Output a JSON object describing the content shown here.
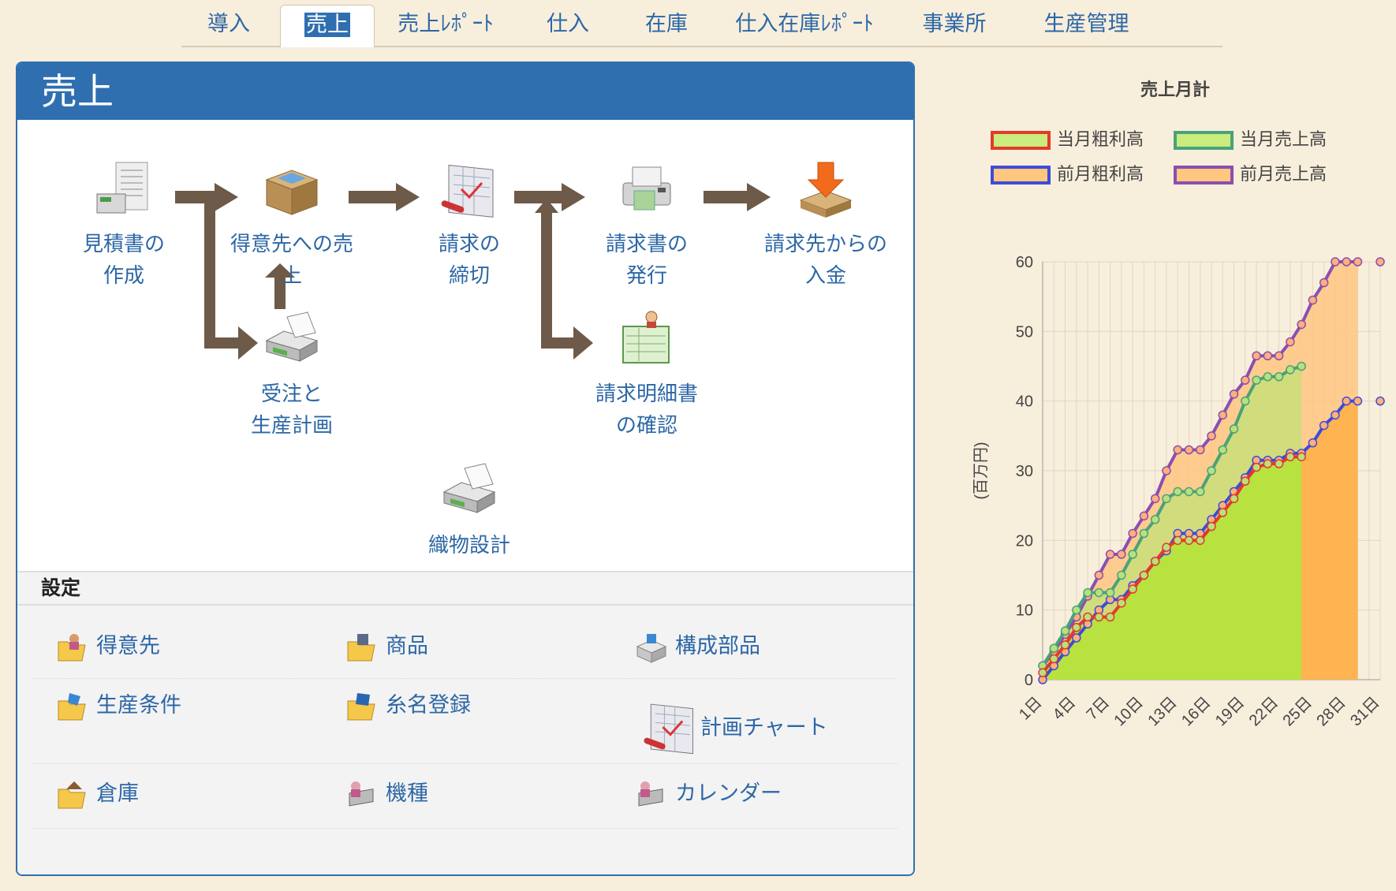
{
  "tabs": [
    {
      "label": "導入",
      "active": false
    },
    {
      "label": "売上",
      "active": true
    },
    {
      "label": "売上ﾚﾎﾟｰﾄ",
      "active": false
    },
    {
      "label": "仕入",
      "active": false
    },
    {
      "label": "在庫",
      "active": false
    },
    {
      "label": "仕入在庫ﾚﾎﾟｰﾄ",
      "active": false
    },
    {
      "label": "事業所",
      "active": false
    },
    {
      "label": "生産管理",
      "active": false
    }
  ],
  "panel": {
    "title": "売上",
    "flow": {
      "estimate": "見積書の\n作成",
      "sales": "得意先への売\n上",
      "closing": "請求の\n締切",
      "invoice": "請求書の\n発行",
      "payment": "請求先からの\n入金",
      "order": "受注と\n生産計画",
      "statement": "請求明細書\nの確認",
      "textile": "織物設計"
    },
    "settings_title": "設定",
    "settings": [
      {
        "label": "得意先",
        "icon": "folder-user-icon"
      },
      {
        "label": "商品",
        "icon": "folder-product-icon"
      },
      {
        "label": "構成部品",
        "icon": "parts-box-icon"
      },
      {
        "label": "生産条件",
        "icon": "folder-condition-icon"
      },
      {
        "label": "糸名登録",
        "icon": "folder-yarn-icon"
      },
      {
        "label": "計画チャート",
        "icon": "chart-sheet-icon"
      },
      {
        "label": "倉庫",
        "icon": "folder-warehouse-icon"
      },
      {
        "label": "機種",
        "icon": "machine-icon"
      },
      {
        "label": "カレンダー",
        "icon": "calendar-icon"
      }
    ]
  },
  "colors": {
    "accent": "#2f6fb0",
    "link": "#2c67a6",
    "background": "#f8eedc",
    "arrow": "#6e5a48",
    "cur_gross_line": "#e33a2b",
    "cur_sales_line": "#4aa27a",
    "prev_gross_line": "#3f4bd6",
    "prev_sales_line": "#8a4fb0",
    "green_fill": "#b5e33a",
    "orange_fill": "#ffb04a"
  },
  "chart_data": {
    "type": "area",
    "title": "売上月計",
    "ylabel": "(百万円)",
    "ylim": [
      0,
      60
    ],
    "yticks": [
      0,
      10,
      20,
      30,
      40,
      50,
      60
    ],
    "xticks": [
      "1日",
      "4日",
      "7日",
      "10日",
      "13日",
      "16日",
      "19日",
      "22日",
      "25日",
      "28日",
      "31日"
    ],
    "legend": [
      {
        "name": "当月粗利高",
        "fill": "#c9ec7c",
        "border": "#e33a2b"
      },
      {
        "name": "当月売上高",
        "fill": "#c9ec7c",
        "border": "#4aa27a"
      },
      {
        "name": "前月粗利高",
        "fill": "#ffc680",
        "border": "#3f4bd6"
      },
      {
        "name": "前月売上高",
        "fill": "#ffc680",
        "border": "#8a4fb0"
      }
    ],
    "series": [
      {
        "name": "当月売上高",
        "days": [
          1,
          2,
          3,
          4,
          5,
          6,
          7,
          8,
          9,
          10,
          11,
          12,
          13,
          14,
          15,
          16,
          17,
          18,
          19,
          20,
          21,
          22,
          23,
          24
        ],
        "values": [
          2,
          4.5,
          7,
          10,
          12.5,
          12.5,
          12.5,
          15,
          18,
          21,
          23,
          26,
          27,
          27,
          27,
          30,
          33,
          36,
          40,
          43,
          43.5,
          43.5,
          44.5,
          45
        ]
      },
      {
        "name": "当月粗利高",
        "days": [
          1,
          2,
          3,
          4,
          5,
          6,
          7,
          8,
          9,
          10,
          11,
          12,
          13,
          14,
          15,
          16,
          17,
          18,
          19,
          20,
          21,
          22,
          23,
          24
        ],
        "values": [
          1,
          3,
          5,
          7.5,
          9,
          9,
          9,
          11,
          13,
          15,
          17,
          19,
          20,
          20,
          20,
          22,
          24,
          26,
          28.5,
          30.5,
          31,
          31,
          32,
          32
        ]
      },
      {
        "name": "前月売上高",
        "days": [
          1,
          2,
          3,
          4,
          5,
          6,
          7,
          8,
          9,
          10,
          11,
          12,
          13,
          14,
          15,
          16,
          17,
          18,
          19,
          20,
          21,
          22,
          23,
          24,
          25,
          26,
          27,
          28,
          29,
          31
        ],
        "values": [
          2,
          4,
          6.5,
          9,
          12,
          15,
          18,
          18,
          21,
          23.5,
          26,
          30,
          33,
          33,
          33,
          35,
          38,
          41,
          43,
          46.5,
          46.5,
          46.5,
          48.5,
          51,
          54.5,
          57,
          60,
          60,
          60,
          60
        ]
      },
      {
        "name": "前月粗利高",
        "days": [
          1,
          2,
          3,
          4,
          5,
          6,
          7,
          8,
          9,
          10,
          11,
          12,
          13,
          14,
          15,
          16,
          17,
          18,
          19,
          20,
          21,
          22,
          23,
          24,
          25,
          26,
          27,
          28,
          29,
          31
        ],
        "values": [
          0,
          2,
          4,
          6,
          8,
          10,
          11.5,
          11.5,
          13.5,
          15,
          17,
          18.5,
          21,
          21,
          21,
          23,
          25,
          27,
          29,
          31.5,
          31.5,
          31.5,
          32.5,
          32.5,
          34,
          36.5,
          38,
          40,
          40,
          40
        ]
      }
    ]
  }
}
